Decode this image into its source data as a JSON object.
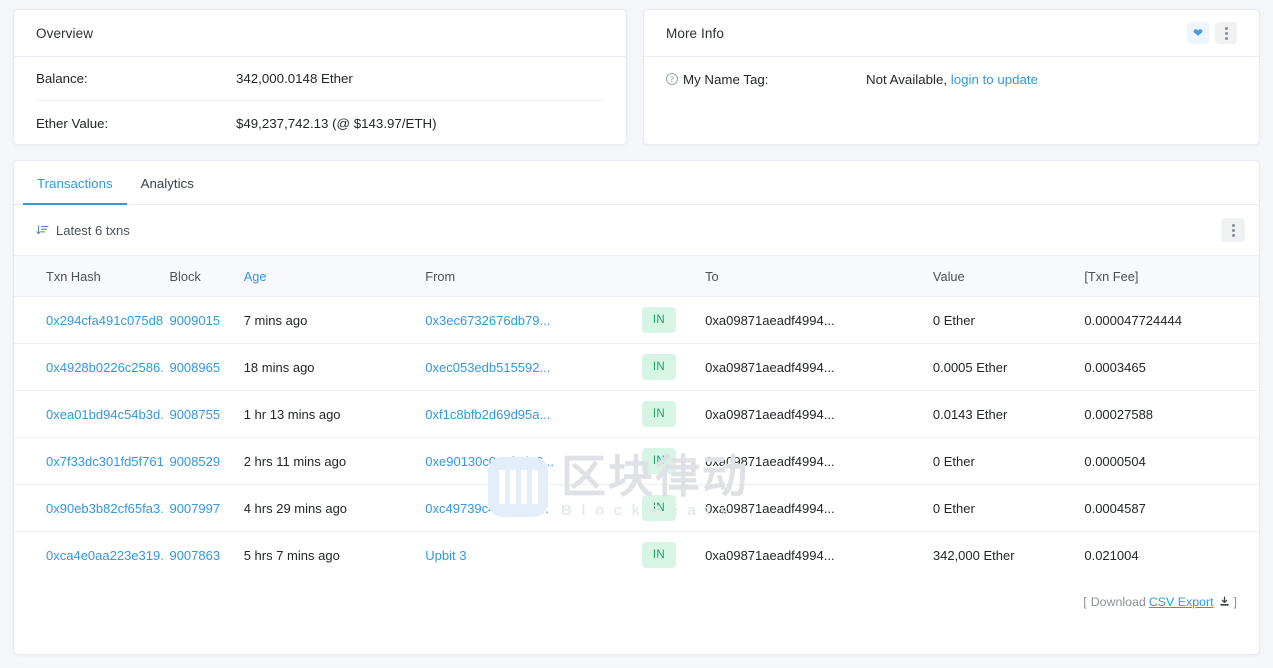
{
  "overview": {
    "title": "Overview",
    "rows": [
      {
        "label": "Balance:",
        "value": "342,000.0148 Ether"
      },
      {
        "label": "Ether Value:",
        "value": "$49,237,742.13 (@ $143.97/ETH)"
      }
    ]
  },
  "more_info": {
    "title": "More Info",
    "favorite_icon": "heart-icon",
    "menu_icon": "kebab-menu-icon",
    "name_tag": {
      "help_icon": "question-mark-icon",
      "label": "My Name Tag:",
      "value": "Not Available,",
      "link": "login to update"
    }
  },
  "tabs": [
    {
      "label": "Transactions",
      "active": true
    },
    {
      "label": "Analytics",
      "active": false
    }
  ],
  "subbar": {
    "sort_icon": "sort-descending-icon",
    "text": "Latest 6 txns",
    "menu_icon": "kebab-menu-icon"
  },
  "table": {
    "columns": [
      {
        "key": "hash",
        "label": "Txn Hash",
        "sorted": false
      },
      {
        "key": "block",
        "label": "Block",
        "sorted": false
      },
      {
        "key": "age",
        "label": "Age",
        "sorted": true
      },
      {
        "key": "from",
        "label": "From",
        "sorted": false
      },
      {
        "key": "dir",
        "label": "",
        "sorted": false
      },
      {
        "key": "to",
        "label": "To",
        "sorted": false
      },
      {
        "key": "value",
        "label": "Value",
        "sorted": false
      },
      {
        "key": "fee",
        "label": "[Txn Fee]",
        "sorted": false
      }
    ],
    "rows": [
      {
        "hash": "0x294cfa491c075d8...",
        "block": "9009015",
        "age": "7 mins ago",
        "from": "0x3ec6732676db79...",
        "dir": "IN",
        "to": "0xa09871aeadf4994...",
        "value": "0 Ether",
        "fee": "0.000047724444"
      },
      {
        "hash": "0x4928b0226c2586...",
        "block": "9008965",
        "age": "18 mins ago",
        "from": "0xec053edb515592...",
        "dir": "IN",
        "to": "0xa09871aeadf4994...",
        "value": "0.0005 Ether",
        "fee": "0.0003465"
      },
      {
        "hash": "0xea01bd94c54b3d...",
        "block": "9008755",
        "age": "1 hr 13 mins ago",
        "from": "0xf1c8bfb2d69d95a...",
        "dir": "IN",
        "to": "0xa09871aeadf4994...",
        "value": "0.0143 Ether",
        "fee": "0.00027588"
      },
      {
        "hash": "0x7f33dc301fd5f761...",
        "block": "9008529",
        "age": "2 hrs 11 mins ago",
        "from": "0xe90130c0aef0da6...",
        "dir": "IN",
        "to": "0xa09871aeadf4994...",
        "value": "0 Ether",
        "fee": "0.0000504"
      },
      {
        "hash": "0x90eb3b82cf65fa3...",
        "block": "9007997",
        "age": "4 hrs 29 mins ago",
        "from": "0xc49739c49bca25...",
        "dir": "IN",
        "to": "0xa09871aeadf4994...",
        "value": "0 Ether",
        "fee": "0.0004587"
      },
      {
        "hash": "0xca4e0aa223e319...",
        "block": "9007863",
        "age": "5 hrs 7 mins ago",
        "from": "Upbit 3",
        "dir": "IN",
        "to": "0xa09871aeadf4994...",
        "value": "342,000 Ether",
        "fee": "0.021004"
      }
    ]
  },
  "footer": {
    "bracket_open": "[",
    "download_label": "Download",
    "csv_label": "CSV Export",
    "download_icon": "download-icon",
    "bracket_close": "]"
  },
  "watermark": {
    "logo_icon": "blockbeats-logo-icon",
    "cn": "区块律动",
    "en": "BlockBeats"
  },
  "colors": {
    "link": "#3498db",
    "badge_in_bg": "#d6f5e5",
    "badge_in_text": "#23a06b",
    "page_bg": "#f5f6fa",
    "border": "#e7eaf3"
  }
}
